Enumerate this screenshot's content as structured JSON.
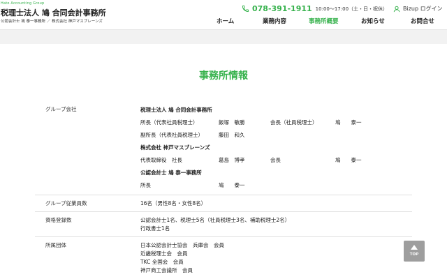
{
  "header": {
    "brand_sub": "Hato Accounting Group",
    "brand_title": "税理士法人 鳩 合同会計事務所",
    "brand_desc": "公認会計士 鳩 泰一事務所 ／ 株式会社 神戸マスブレーンズ",
    "phone_icon": "phone-icon",
    "phone": "078-391-1911",
    "hours": "10:00〜17:00（土・日・祝休）",
    "login_icon": "user-icon",
    "login_label": "Bizup ログイン"
  },
  "nav": {
    "items": [
      {
        "label": "ホーム"
      },
      {
        "label": "業務内容"
      },
      {
        "label": "事務所概要",
        "active": true
      },
      {
        "label": "お知らせ"
      },
      {
        "label": "お問合せ"
      }
    ]
  },
  "main": {
    "title": "事務所情報",
    "rows": {
      "group": {
        "label": "グループ会社",
        "org1": "税理士法人 鳩 合同会計事務所",
        "l1": [
          "所長（代表社員税理士）",
          "飯塚　敏勝",
          "会長（社員税理士）",
          "鳩　　泰一"
        ],
        "l2": [
          "副所長（代表社員税理士）",
          "藤田　和久"
        ],
        "org2": "株式会社 神戸マスブレーンズ",
        "l3": [
          "代表取締役　社長",
          "葛島　博孝",
          "会長",
          "鳩　　泰一"
        ],
        "org3": "公認会計士 鳩 泰一事務所",
        "l4": [
          "所長",
          "鳩　　泰一"
        ]
      },
      "staff": {
        "label": "グループ従業員数",
        "value": "16名（男性8名・女性8名）"
      },
      "licenses": {
        "label": "資格登録数",
        "lines": [
          "公認会計士1名、税理士5名（社員税理士3名、補助税理士2名）",
          "行政書士1名"
        ]
      },
      "affiliations": {
        "label": "所属団体",
        "lines": [
          "日本公認会計士協会　兵庫会　会員",
          "近畿税理士会　会員",
          "TKC 全国会　会員",
          "神戸商工会議所　会員"
        ]
      }
    }
  },
  "top_button": {
    "icon": "arrow-up-icon",
    "label": "TOP"
  },
  "colors": {
    "accent": "#37b24d",
    "band": "#f2f2f2",
    "top_button": "#9e9e9e"
  }
}
